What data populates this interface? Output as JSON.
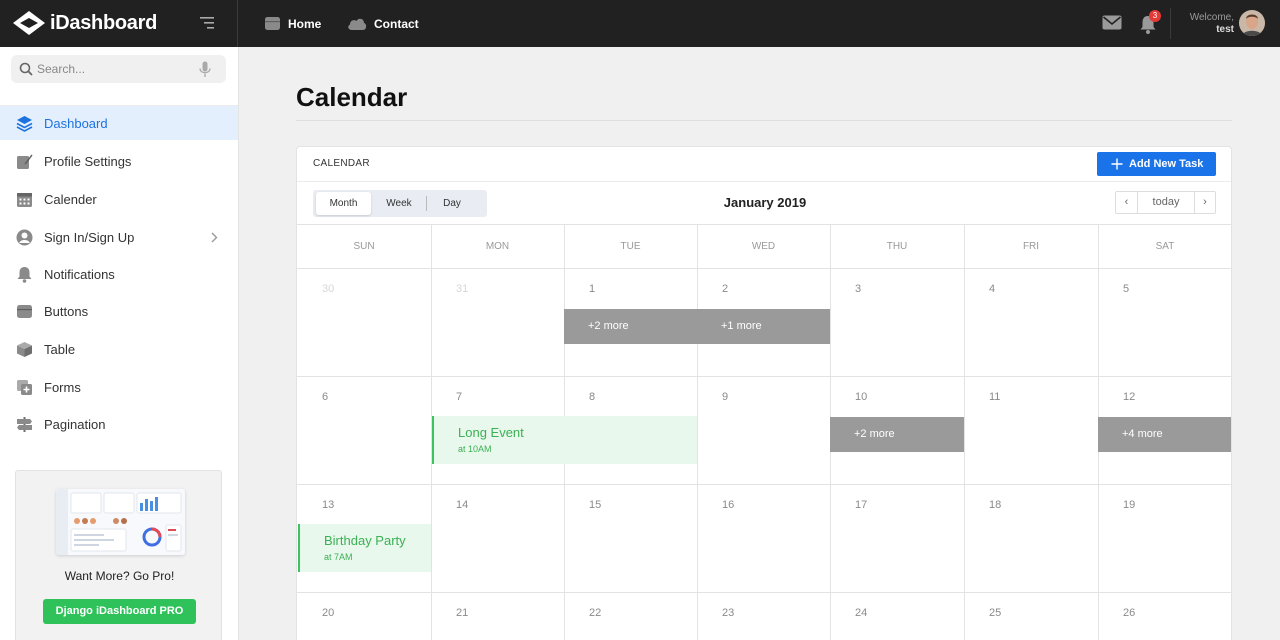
{
  "brand": {
    "name": "iDashboard"
  },
  "topnav": {
    "home": "Home",
    "contact": "Contact"
  },
  "header": {
    "notification_count": "3",
    "welcome": "Welcome,",
    "username": "test"
  },
  "search": {
    "placeholder": "Search..."
  },
  "sidebar": {
    "items": [
      {
        "label": "Dashboard",
        "icon": "layers-icon"
      },
      {
        "label": "Profile Settings",
        "icon": "edit-icon"
      },
      {
        "label": "Calender",
        "icon": "calendar-icon"
      },
      {
        "label": "Sign In/Sign Up",
        "icon": "user-icon"
      },
      {
        "label": "Notifications",
        "icon": "bell-icon"
      },
      {
        "label": "Buttons",
        "icon": "box-icon"
      },
      {
        "label": "Table",
        "icon": "cube-icon"
      },
      {
        "label": "Forms",
        "icon": "forms-icon"
      },
      {
        "label": "Pagination",
        "icon": "signpost-icon"
      }
    ],
    "active_index": 0
  },
  "promo": {
    "title": "Want More? Go Pro!",
    "button": "Django iDashboard PRO"
  },
  "page": {
    "title": "Calendar"
  },
  "calendar": {
    "card_label": "CALENDAR",
    "add_button": "Add New Task",
    "views": [
      "Month",
      "Week",
      "Day"
    ],
    "active_view": "Month",
    "month_title": "January 2019",
    "nav": {
      "prev": "‹",
      "today": "today",
      "next": "›"
    },
    "weekdays": [
      "SUN",
      "MON",
      "TUE",
      "WED",
      "THU",
      "FRI",
      "SAT"
    ],
    "weeks": [
      [
        "30",
        "31",
        "1",
        "2",
        "3",
        "4",
        "5"
      ],
      [
        "6",
        "7",
        "8",
        "9",
        "10",
        "11",
        "12"
      ],
      [
        "13",
        "14",
        "15",
        "16",
        "17",
        "18",
        "19"
      ],
      [
        "20",
        "21",
        "22",
        "23",
        "24",
        "25",
        "26"
      ]
    ],
    "more_links": [
      {
        "text": "+2 more",
        "week": 0,
        "day": 2
      },
      {
        "text": "+1 more",
        "week": 0,
        "day": 3
      },
      {
        "text": "+2 more",
        "week": 1,
        "day": 4
      },
      {
        "text": "+4 more",
        "week": 1,
        "day": 6
      }
    ],
    "events": [
      {
        "title": "Long Event",
        "time": "at 10AM",
        "week": 1,
        "start_day": 1,
        "span": 2
      },
      {
        "title": "Birthday Party",
        "time": "at 7AM",
        "week": 2,
        "start_day": 0,
        "span": 1
      }
    ]
  },
  "colors": {
    "topbar": "#212121",
    "accent": "#1a73e8",
    "event_green": "#3cb054",
    "more_gray": "#9a9a9a",
    "pro_green": "#2fc25b"
  }
}
